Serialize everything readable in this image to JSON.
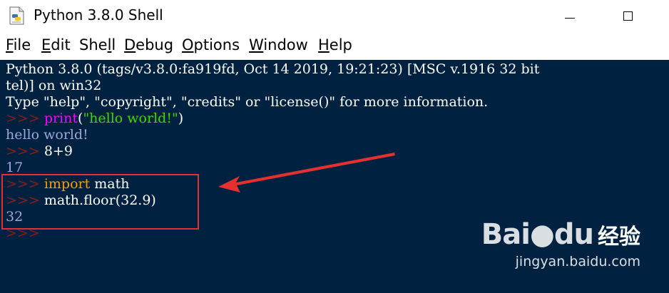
{
  "window": {
    "title": "Python 3.8.0 Shell",
    "app_icon": "python-idle-icon",
    "controls": {
      "minimize_icon": "minimize-icon",
      "maximize_icon": "maximize-icon"
    }
  },
  "menu": [
    {
      "label_first": "F",
      "label_rest": "ile"
    },
    {
      "label_first": "E",
      "label_rest": "dit"
    },
    {
      "label_first": "She",
      "label_mn": "l",
      "label_rest": "l"
    },
    {
      "label_first": "D",
      "label_rest": "ebug"
    },
    {
      "label_first": "O",
      "label_rest": "ptions"
    },
    {
      "label_first": "W",
      "label_rest": "indow"
    },
    {
      "label_first": "H",
      "label_rest": "elp"
    }
  ],
  "shell": {
    "banner1": "Python 3.8.0 (tags/v3.8.0:fa919fd, Oct 14 2019, 19:21:23) [MSC v.1916 32 bit",
    "banner2": "tel)] on win32",
    "banner3": "Type \"help\", \"copyright\", \"credits\" or \"license()\" for more information.",
    "prompt": ">>>",
    "l1_func": "print",
    "l1_open": "(",
    "l1_str": "\"hello world!\"",
    "l1_close": ")",
    "out1": "hello world!",
    "l2_code": "8+9",
    "out2": "17",
    "l3_kw": "import",
    "l3_rest": " math",
    "l4_code": "math.floor(32.9)",
    "out4": "32"
  },
  "colors": {
    "shell_bg": "#002240",
    "prompt": "#8a1f17",
    "keyword": "#ff9d00",
    "builtin": "#ff00ff",
    "string": "#3ad900",
    "output": "#9ea6d6",
    "annotation": "#e53030"
  },
  "watermark": {
    "logo": "Bai",
    "logo_icon": "baidu-paw-icon",
    "logo_tail": "du",
    "jingyan": "经验",
    "url": "jingyan.baidu.com"
  }
}
